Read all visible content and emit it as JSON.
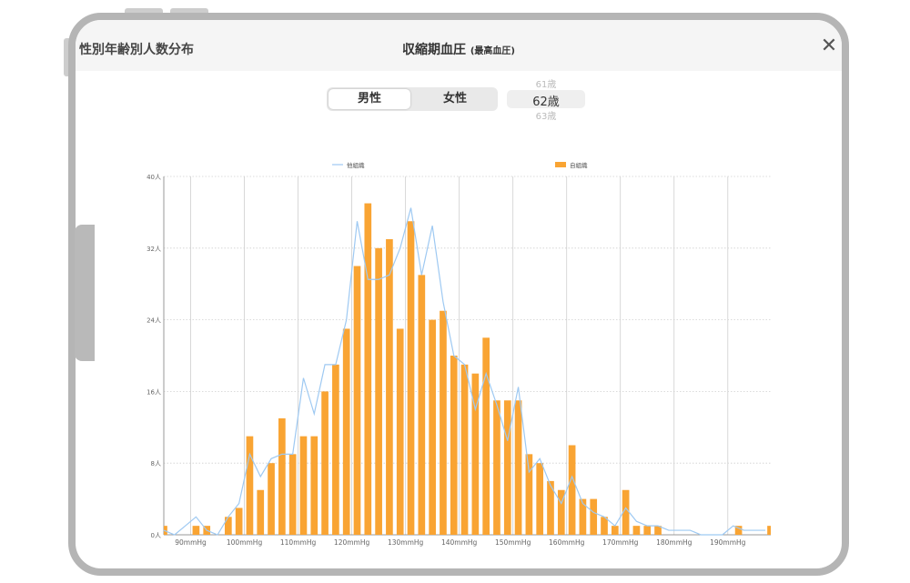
{
  "header": {
    "left_title": "性別年齢別人数分布",
    "title": "収縮期血圧",
    "subtitle": "(最高血圧)",
    "close_label": "✕"
  },
  "gender_toggle": {
    "male": "男性",
    "female": "女性",
    "selected": "男性"
  },
  "age_picker": {
    "prev": "61歳",
    "current": "62歳",
    "next": "63歳"
  },
  "colors": {
    "bar": "#f9a433",
    "line": "#9ec9f2",
    "grid": "#cfcfcf",
    "axis": "#999999"
  },
  "chart_data": {
    "type": "bar",
    "legend": {
      "line_label": "他組織",
      "bar_label": "自組織",
      "placement": "top"
    },
    "ylim": [
      0,
      40
    ],
    "y_ticks": [
      0,
      8,
      16,
      24,
      32,
      40
    ],
    "y_tick_labels": [
      "0人",
      "8人",
      "16人",
      "24人",
      "32人",
      "40人"
    ],
    "x_range": [
      85,
      198
    ],
    "x_ticks": [
      90,
      100,
      110,
      120,
      130,
      140,
      150,
      160,
      170,
      180,
      190
    ],
    "x_tick_labels": [
      "90mmHg",
      "100mmHg",
      "110mmHg",
      "120mmHg",
      "130mmHg",
      "140mmHg",
      "150mmHg",
      "160mmHg",
      "170mmHg",
      "180mmHg",
      "190mmHg"
    ],
    "series": [
      {
        "name": "自組織",
        "type": "bar",
        "x": [
          85,
          91,
          93,
          97,
          99,
          101,
          103,
          105,
          107,
          109,
          111,
          113,
          115,
          117,
          119,
          121,
          123,
          125,
          127,
          129,
          131,
          133,
          135,
          137,
          139,
          141,
          143,
          145,
          147,
          149,
          151,
          153,
          155,
          157,
          159,
          161,
          163,
          165,
          167,
          169,
          171,
          173,
          175,
          177,
          192,
          198
        ],
        "values": [
          1,
          1,
          1,
          2,
          3,
          11,
          5,
          8,
          13,
          9,
          11,
          11,
          16,
          19,
          23,
          30,
          37,
          32,
          33,
          23,
          35,
          29,
          24,
          25,
          20,
          19,
          18,
          22,
          15,
          15,
          15,
          9,
          8,
          6,
          5,
          10,
          4,
          4,
          2,
          1,
          5,
          1,
          1,
          1,
          1,
          1
        ]
      },
      {
        "name": "他組織",
        "type": "line",
        "x": [
          85,
          87,
          89,
          91,
          93,
          95,
          97,
          99,
          101,
          103,
          105,
          107,
          109,
          111,
          113,
          115,
          117,
          119,
          121,
          123,
          125,
          127,
          129,
          131,
          133,
          135,
          137,
          139,
          141,
          143,
          145,
          147,
          149,
          151,
          153,
          155,
          157,
          159,
          161,
          163,
          165,
          167,
          169,
          171,
          173,
          175,
          177,
          179,
          181,
          183,
          185,
          187,
          189,
          191,
          193,
          195,
          197
        ],
        "values": [
          0.5,
          0,
          1,
          2,
          0.5,
          0,
          2,
          3.5,
          9,
          6.5,
          8.5,
          9,
          9,
          17.5,
          13.5,
          19,
          19,
          24,
          35,
          28.5,
          28.5,
          29,
          32,
          36.5,
          29,
          34.5,
          26,
          20,
          19,
          14,
          18,
          14.5,
          10.5,
          16.5,
          7,
          8.5,
          5.5,
          3.5,
          6.5,
          3.5,
          2.5,
          2,
          1,
          3,
          1.5,
          1,
          1,
          0.5,
          0.5,
          0.5,
          0,
          0,
          0,
          1,
          0.5,
          0.5,
          0.5
        ]
      }
    ]
  }
}
